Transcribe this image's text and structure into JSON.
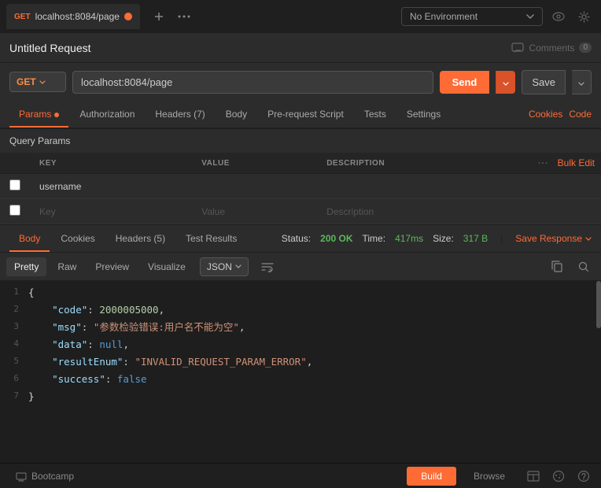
{
  "topbar": {
    "tab": {
      "method": "GET",
      "url": "localhost:8084/page"
    },
    "add_icon": "+",
    "more_icon": "···",
    "env_selector": "No Environment",
    "eye_icon": "👁",
    "gear_icon": "⚙"
  },
  "titlebar": {
    "title": "Untitled Request",
    "comments_label": "Comments",
    "comments_count": "0"
  },
  "urlbar": {
    "method": "GET",
    "url": "localhost:8084/page",
    "send_label": "Send",
    "save_label": "Save"
  },
  "request_tabs": {
    "tabs": [
      "Params",
      "Authorization",
      "Headers (7)",
      "Body",
      "Pre-request Script",
      "Tests",
      "Settings"
    ],
    "active": "Params",
    "right_links": [
      "Cookies",
      "Code"
    ]
  },
  "query_params": {
    "title": "Query Params",
    "columns": {
      "key": "KEY",
      "value": "VALUE",
      "description": "DESCRIPTION",
      "bulk_edit": "Bulk Edit"
    },
    "rows": [
      {
        "key": "username",
        "value": "",
        "description": ""
      }
    ],
    "placeholder": {
      "key": "Key",
      "value": "Value",
      "description": "Description"
    }
  },
  "response_tabs": {
    "tabs": [
      "Body",
      "Cookies",
      "Headers (5)",
      "Test Results"
    ],
    "active": "Body",
    "status": {
      "label": "Status:",
      "code": "200 OK",
      "time_label": "Time:",
      "time": "417ms",
      "size_label": "Size:",
      "size": "317 B"
    },
    "save_response": "Save Response"
  },
  "response_toolbar": {
    "format_tabs": [
      "Pretty",
      "Raw",
      "Preview",
      "Visualize"
    ],
    "active_format": "Pretty",
    "format_type": "JSON",
    "wrap_icon": "wrap",
    "copy_icon": "copy",
    "search_icon": "search"
  },
  "json_response": {
    "lines": [
      {
        "num": 1,
        "content": "{"
      },
      {
        "num": 2,
        "content": "    \"code\": 2000005000,"
      },
      {
        "num": 3,
        "content": "    \"msg\": \"参数检验错误:用户名不能为空\","
      },
      {
        "num": 4,
        "content": "    \"data\": null,"
      },
      {
        "num": 5,
        "content": "    \"resultEnum\": \"INVALID_REQUEST_PARAM_ERROR\","
      },
      {
        "num": 6,
        "content": "    \"success\": false"
      },
      {
        "num": 7,
        "content": "}"
      }
    ]
  },
  "bottombar": {
    "bootcamp": "Bootcamp",
    "tabs": [
      "Build",
      "Browse"
    ],
    "active_tab": "Build",
    "layout_icon": "layout",
    "cookies_icon": "cookies",
    "help_icon": "?"
  }
}
